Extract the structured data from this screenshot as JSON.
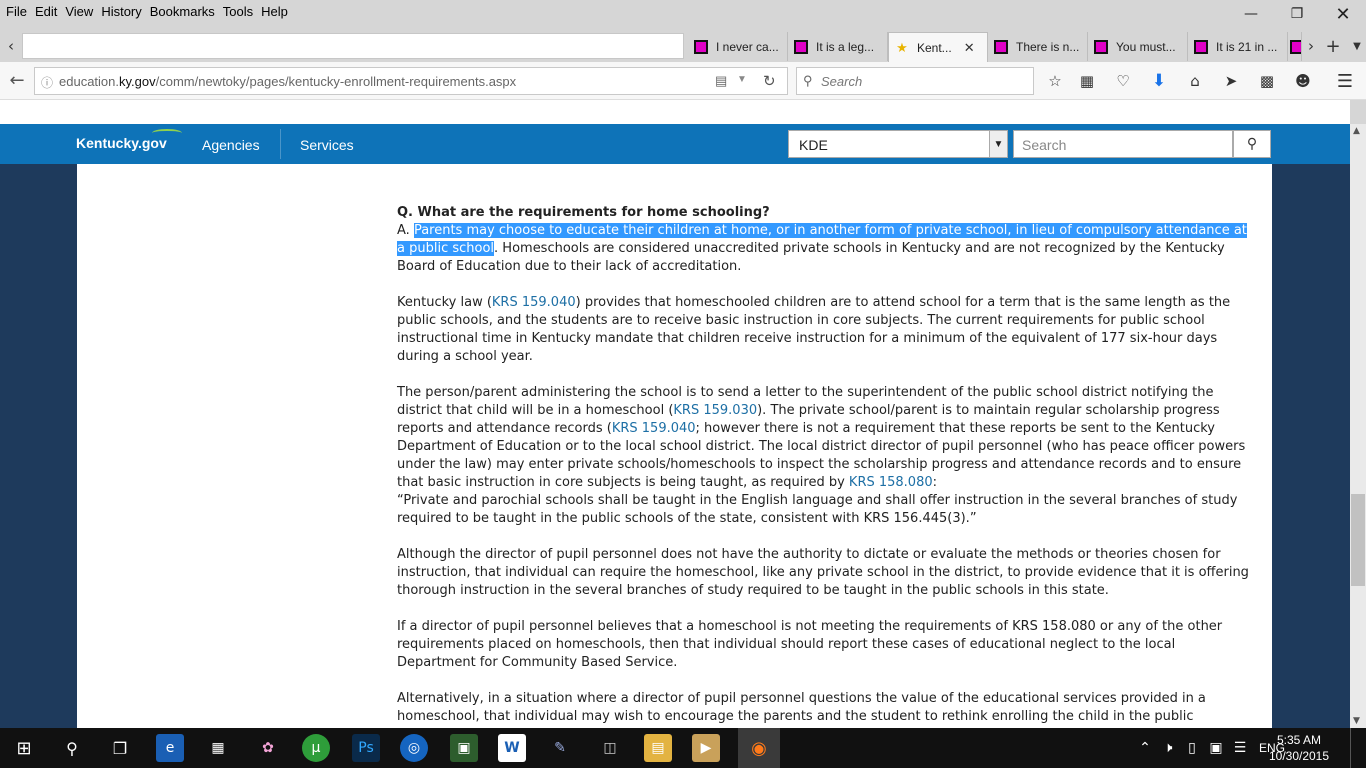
{
  "menubar": {
    "items": [
      {
        "label": "File",
        "key": "F",
        "rest": "ile"
      },
      {
        "label": "Edit",
        "key": "E",
        "rest": "dit"
      },
      {
        "label": "View",
        "key": "V",
        "rest": "iew"
      },
      {
        "label": "History",
        "key": "H",
        "rest": "istory",
        "pre": "Hi",
        "key2": "s",
        "post": "tory"
      },
      {
        "label": "Bookmarks",
        "key": "B",
        "rest": "ookmarks"
      },
      {
        "label": "Tools",
        "key": "T",
        "rest": "ools"
      },
      {
        "label": "Help",
        "key": "H",
        "rest": "elp"
      }
    ]
  },
  "tabs": [
    {
      "title": "I never ca...",
      "active": false
    },
    {
      "title": "It is a leg...",
      "active": false
    },
    {
      "title": "Kent...",
      "active": true
    },
    {
      "title": "There is n...",
      "active": false
    },
    {
      "title": "You must...",
      "active": false
    },
    {
      "title": "It is 21 in ...",
      "active": false
    }
  ],
  "navbar": {
    "url_prefix": "education.",
    "url_domain": "ky.gov",
    "url_path": "/comm/newtoky/pages/kentucky-enrollment-requirements.aspx",
    "search_placeholder": "Search"
  },
  "site_header": {
    "logo": "Kentucky.gov",
    "nav": [
      "Agencies",
      "Services"
    ],
    "select_value": "KDE",
    "search_placeholder": "Search"
  },
  "article": {
    "question": "Q. What are the requirements for home schooling?",
    "a_label": "A. ",
    "a_selected": "Parents may choose to educate their children at home, or in another form of private school, in lieu of compulsory attendance at a public school",
    "a_rest": ". Homeschools are considered unaccredited private schools in Kentucky and are not recognized by the Kentucky Board of Education due to their lack of accreditation.",
    "p2_a": "Kentucky law (",
    "p2_link": "KRS 159.040",
    "p2_b": ") provides that homeschooled children are to attend school for a term that is the same length as the public schools, and the students are to receive basic instruction in core subjects. The current requirements for public school instructional time in Kentucky mandate that children receive instruction for a minimum of the equivalent of 177 six-hour days during a school year.",
    "p3_a": "The person/parent administering the school is to send a letter to the superintendent of the public school district notifying the district that child will be in a homeschool (",
    "p3_link1": "KRS 159.030",
    "p3_b": "). The private school/parent is to maintain regular scholarship progress reports and attendance records (",
    "p3_link2": "KRS 159.040",
    "p3_c": "; however there is not a requirement that these reports be sent to the Kentucky Department of Education or to the local school district. The local district director of pupil personnel (who has peace officer powers under the law) may enter private schools/homeschools to inspect the scholarship progress and attendance records and to ensure that basic instruction in core subjects is being taught, as required by ",
    "p3_link3": "KRS 158.080",
    "p3_d": ":",
    "p3_quote": "“Private and parochial schools shall be taught in the English language and shall offer instruction in the several branches of study required to be taught in the public schools of the state, consistent with KRS 156.445(3).”",
    "p4": "Although the director of pupil personnel does not have the authority to dictate or evaluate the methods or theories chosen for instruction, that individual can require the homeschool, like any private school in the district, to provide evidence that it is offering thorough instruction in the several branches of study required to be taught in the public schools in this state.",
    "p5": "If a director of pupil personnel believes that a homeschool is not meeting the requirements of KRS 158.080 or any of the other requirements placed on homeschools, then that individual should report these cases of educational neglect to the local Department for Community Based Service.",
    "p6": "Alternatively, in a situation where a director of pupil personnel questions the value of the educational services provided in a homeschool, that individual may wish to encourage the parents and the student to rethink enrolling the child in the public"
  },
  "taskbar": {
    "lang": "ENG",
    "time": "5:35 AM",
    "date": "10/30/2015",
    "apps": [
      "Ps",
      "W"
    ]
  },
  "colors": {
    "site_blue": "#0e73b8",
    "side_navy": "#1e3a5c",
    "selection": "#3399ff",
    "link": "#1d6fa5",
    "tab_favicon": "#e100c6"
  }
}
